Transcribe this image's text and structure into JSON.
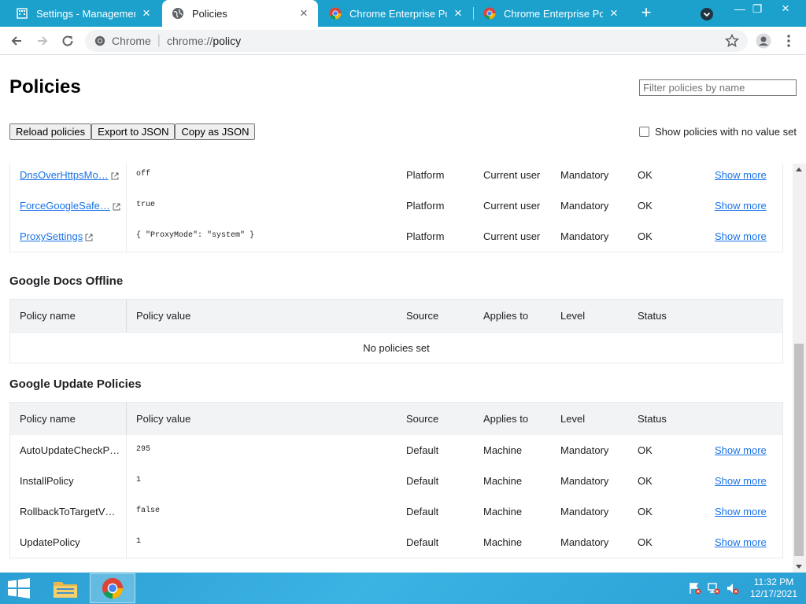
{
  "browser": {
    "tabs": [
      {
        "title": "Settings - Management",
        "active": false
      },
      {
        "title": "Policies",
        "active": true
      },
      {
        "title": "Chrome Enterprise Policy",
        "active": false
      },
      {
        "title": "Chrome Enterprise Policy",
        "active": false
      }
    ],
    "omnibox": {
      "site": "Chrome",
      "scheme": "chrome://",
      "host": "policy"
    }
  },
  "page": {
    "title": "Policies",
    "filter_placeholder": "Filter policies by name",
    "buttons": {
      "reload": "Reload policies",
      "export": "Export to JSON",
      "copy": "Copy as JSON"
    },
    "show_no_value": "Show policies with no value set"
  },
  "columns": {
    "name": "Policy name",
    "value": "Policy value",
    "source": "Source",
    "applies": "Applies to",
    "level": "Level",
    "status": "Status"
  },
  "chrome_policies_tail": [
    {
      "name": "DnsOverHttpsMo…",
      "value": "off",
      "source": "Platform",
      "applies": "Current user",
      "level": "Mandatory",
      "status": "OK",
      "more": "Show more"
    },
    {
      "name": "ForceGoogleSafe…",
      "value": "true",
      "source": "Platform",
      "applies": "Current user",
      "level": "Mandatory",
      "status": "OK",
      "more": "Show more"
    },
    {
      "name": "ProxySettings",
      "value": "{ \"ProxyMode\": \"system\" }",
      "source": "Platform",
      "applies": "Current user",
      "level": "Mandatory",
      "status": "OK",
      "more": "Show more"
    }
  ],
  "docs_offline": {
    "title": "Google Docs Offline",
    "empty": "No policies set"
  },
  "update": {
    "title": "Google Update Policies",
    "rows": [
      {
        "name": "AutoUpdateCheckP…",
        "value": "295",
        "source": "Default",
        "applies": "Machine",
        "level": "Mandatory",
        "status": "OK",
        "more": "Show more"
      },
      {
        "name": "InstallPolicy",
        "value": "1",
        "source": "Default",
        "applies": "Machine",
        "level": "Mandatory",
        "status": "OK",
        "more": "Show more"
      },
      {
        "name": "RollbackToTargetV…",
        "value": "false",
        "source": "Default",
        "applies": "Machine",
        "level": "Mandatory",
        "status": "OK",
        "more": "Show more"
      },
      {
        "name": "UpdatePolicy",
        "value": "1",
        "source": "Default",
        "applies": "Machine",
        "level": "Mandatory",
        "status": "OK",
        "more": "Show more"
      }
    ]
  },
  "taskbar": {
    "time": "11:32 PM",
    "date": "12/17/2021"
  },
  "colors": {
    "tabstrip": "#1ca0cc",
    "link": "#1a73e8",
    "header_row": "#f1f3f4"
  }
}
